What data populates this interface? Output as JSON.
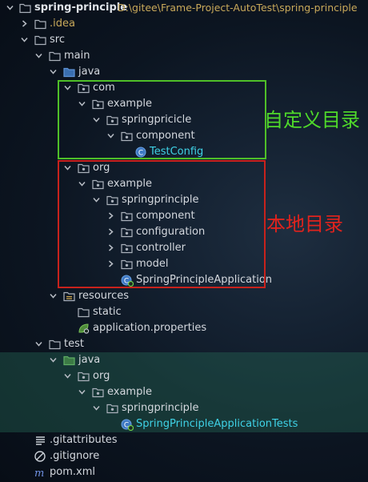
{
  "project": {
    "name": "spring-principle",
    "path": "D:\\gitee\\Frame-Project-AutoTest\\spring-principle"
  },
  "tree": {
    "idea": ".idea",
    "src": "src",
    "main": "main",
    "java_main": "java",
    "com": "com",
    "com_example": "example",
    "springpricicle": "springpricicle",
    "com_component": "component",
    "test_config": "TestConfig",
    "org": "org",
    "org_example": "example",
    "springprinciple": "springprinciple",
    "org_component": "component",
    "configuration": "configuration",
    "controller": "controller",
    "model": "model",
    "app_class": "SpringPrincipleApplication",
    "resources": "resources",
    "static": "static",
    "app_properties": "application.properties",
    "test": "test",
    "java_test": "java",
    "test_org": "org",
    "test_example": "example",
    "test_springprinciple": "springprinciple",
    "test_class": "SpringPrincipleApplicationTests",
    "gitattributes": ".gitattributes",
    "gitignore": ".gitignore",
    "pom": "pom.xml"
  },
  "annotations": {
    "custom_dir": "自定义目录",
    "local_dir": "本地目录"
  },
  "colors": {
    "green_box": "#4fbf28",
    "red_box": "#c8221c",
    "class_name": "#3fd2e6",
    "path_text": "#c9a95a"
  }
}
